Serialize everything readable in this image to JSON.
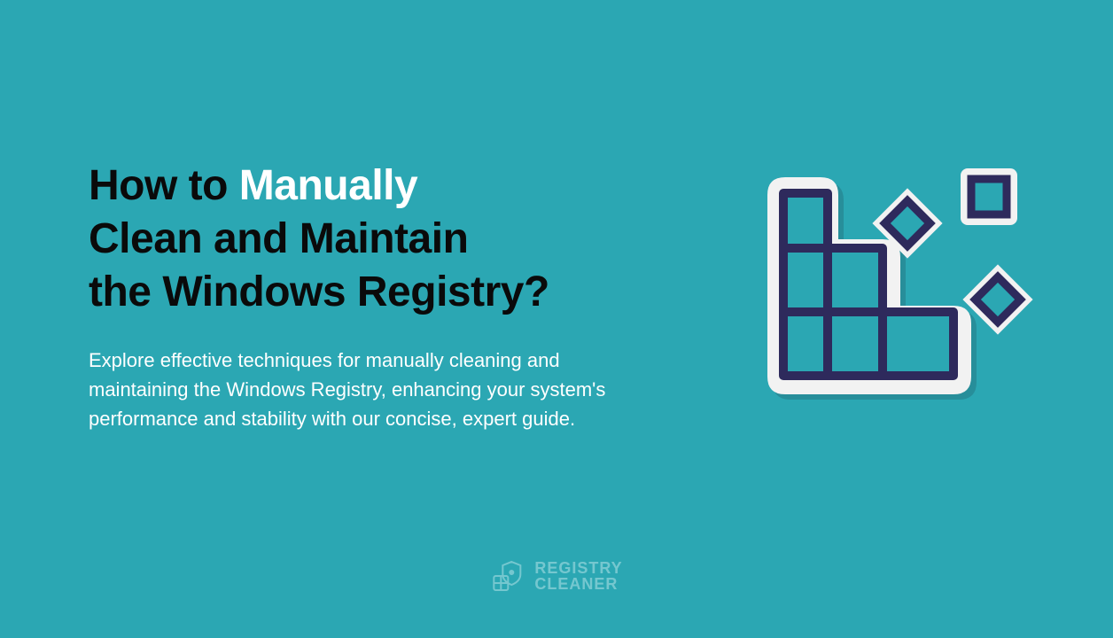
{
  "title": {
    "part1": "How to ",
    "highlight": "Manually",
    "part2": "Clean and Maintain",
    "part3": "the Windows Registry?"
  },
  "subtitle": "Explore effective techniques for manually cleaning and maintaining the Windows Registry, enhancing your system's performance and stability with our concise, expert guide.",
  "brand": {
    "line1": "REGISTRY",
    "line2": "CLEANER"
  }
}
